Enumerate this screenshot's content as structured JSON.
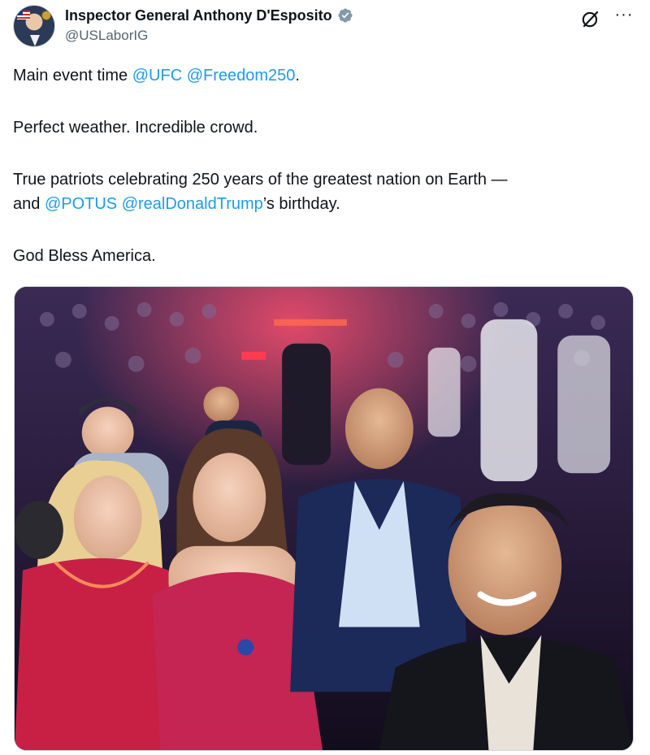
{
  "author": {
    "display_name": "Inspector General Anthony D'Esposito",
    "handle": "@USLaborIG",
    "verified_color": "#829aab"
  },
  "post": {
    "line1_prefix": "Main event time ",
    "mention_ufc": "@UFC",
    "mention_freedom": "@Freedom250",
    "line1_suffix": ".",
    "line2": "Perfect weather. Incredible crowd.",
    "line3": "True patriots celebrating 250 years of the greatest nation on Earth —",
    "line4_prefix": "and ",
    "mention_potus": "@POTUS",
    "mention_trump": "@realDonaldTrump",
    "line4_suffix": "’s birthday.",
    "line5": "God Bless America."
  },
  "icons": {
    "grok": "grok-icon",
    "more": "more-icon",
    "verified": "verified-badge-icon"
  },
  "colors": {
    "link": "#1d9bf0",
    "text": "#0f1419",
    "secondary": "#536471",
    "arena_light": "#e63a5a"
  },
  "media": {
    "type": "photo",
    "scene": "selfie-ringside-arena"
  }
}
